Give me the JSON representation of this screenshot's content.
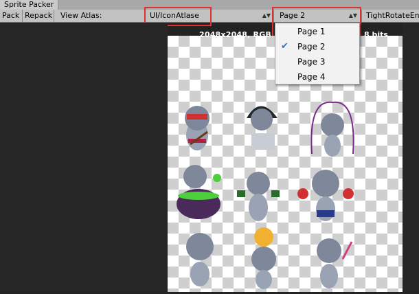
{
  "window": {
    "title": "Sprite Packer"
  },
  "toolbar": {
    "pack_label": "Pack",
    "repack_label": "Repack",
    "view_atlas_label": "View Atlas:",
    "atlas_value": "UI/IconAtlase",
    "page_value": "Page 2",
    "packer_policy": "TightRotateEna"
  },
  "atlas_info": {
    "size_text": "2048x2048, RGB",
    "bits_text": "8 bits"
  },
  "page_menu": {
    "items": [
      {
        "label": "Page 1",
        "checked": false
      },
      {
        "label": "Page 2",
        "checked": true
      },
      {
        "label": "Page 3",
        "checked": false
      },
      {
        "label": "Page 4",
        "checked": false
      }
    ]
  },
  "colors": {
    "highlight": "#e03030",
    "check": "#2a6fd6",
    "checker_light": "#ffffff",
    "checker_dark": "#cfcfcf"
  }
}
